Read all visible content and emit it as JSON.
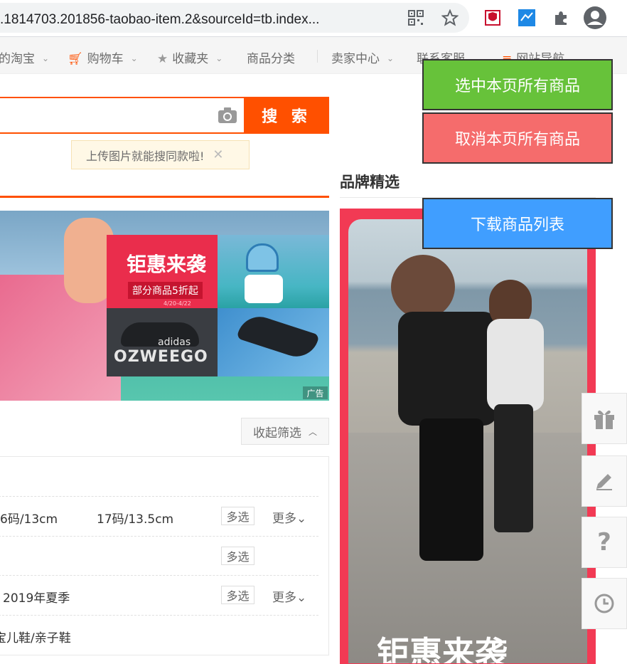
{
  "browser": {
    "url": ".1814703.201856-taobao-item.2&sourceId=tb.index...",
    "icons": [
      "qr-code-icon",
      "star-icon",
      "shield-extension-icon",
      "map-extension-icon",
      "puzzle-icon",
      "account-icon"
    ]
  },
  "site_nav": {
    "items": [
      {
        "label": "的淘宝",
        "dropdown": true
      },
      {
        "label": "购物车",
        "dropdown": true,
        "icon": "cart-icon"
      },
      {
        "label": "收藏夹",
        "dropdown": true,
        "icon": "star-icon"
      },
      {
        "label": "商品分类",
        "dropdown": false
      },
      {
        "label": "卖家中心",
        "dropdown": true
      },
      {
        "label": "联系客服",
        "dropdown": true
      },
      {
        "label": "网站导航",
        "dropdown": true,
        "icon": "menu-icon"
      }
    ]
  },
  "search": {
    "button_label": "搜 索",
    "tip": "上传图片就能搜同款啦!"
  },
  "banner": {
    "headline": "钜惠来袭",
    "sub": "部分商品5折起",
    "date": "4/20-4/22",
    "brand": "adidas",
    "product": "OZWEEGO",
    "ad_tag": "广告"
  },
  "filter": {
    "collapse_label": "收起筛选",
    "rows": [
      {
        "values": [
          "6码/13cm",
          "17码/13.5cm"
        ],
        "multi": "多选",
        "more": "更多"
      },
      {
        "values": [],
        "multi": "多选",
        "more": ""
      },
      {
        "values": [
          "2019年夏季"
        ],
        "multi": "多选",
        "more": "更多"
      },
      {
        "values": [
          "宝儿鞋/亲子鞋"
        ],
        "multi": "",
        "more": ""
      }
    ]
  },
  "brand": {
    "title": "品牌精选",
    "ad_headline": "钜惠来袭"
  },
  "overlay": {
    "select_all": "选中本页所有商品",
    "deselect_all": "取消本页所有商品",
    "download": "下载商品列表",
    "colors": {
      "select": "#67c23a",
      "deselect": "#f56c6c",
      "download": "#409eff"
    }
  },
  "side_tools": [
    "gift-icon",
    "edit-icon",
    "help-icon",
    "history-icon"
  ]
}
